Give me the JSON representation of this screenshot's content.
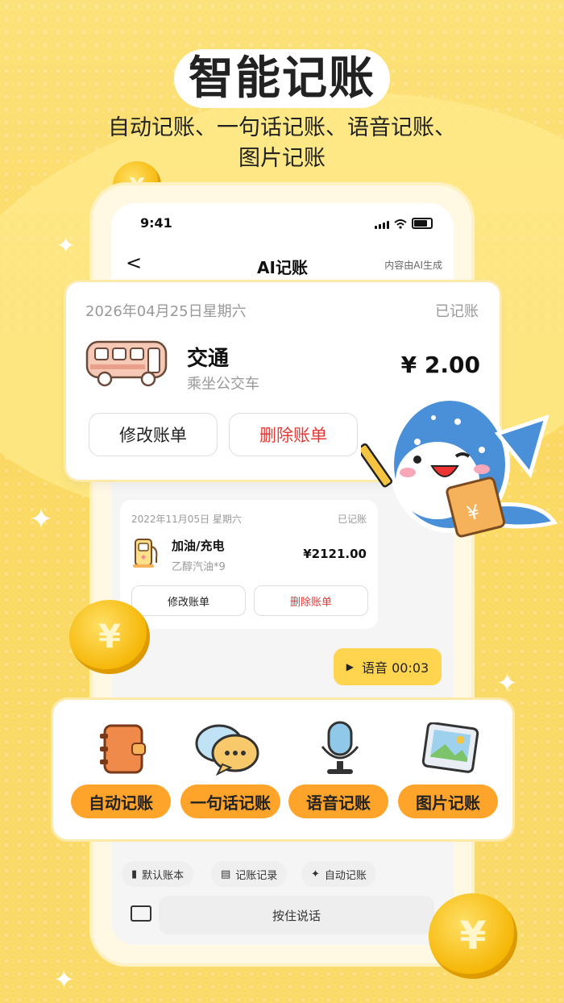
{
  "promo": {
    "title": "智能记账",
    "subtitle_line1": "自动记账、一句话记账、语音记账、",
    "subtitle_line2": "图片记账"
  },
  "status_bar": {
    "time": "9:41"
  },
  "nav": {
    "back": "<",
    "title": "AI记账",
    "note": "内容由AI生成"
  },
  "main_card": {
    "date": "2026年04月25日星期六",
    "status": "已记账",
    "category": "交通",
    "description": "乘坐公交车",
    "amount": "¥ 2.00",
    "edit_label": "修改账单",
    "delete_label": "删除账单"
  },
  "small_card": {
    "date": "2022年11月05日  星期六",
    "status": "已记账",
    "category": "加油/充电",
    "description": "乙醇汽油*9",
    "amount": "¥2121.00",
    "edit_label": "修改账单",
    "delete_label": "删除账单"
  },
  "voice_message": {
    "label": "语音 00:03"
  },
  "features": [
    {
      "label": "自动记账",
      "icon": "notebook-icon"
    },
    {
      "label": "一句话记账",
      "icon": "chat-bubble-icon"
    },
    {
      "label": "语音记账",
      "icon": "microphone-icon"
    },
    {
      "label": "图片记账",
      "icon": "picture-icon"
    }
  ],
  "chips": [
    {
      "label": "默认账本",
      "icon": "book-icon"
    },
    {
      "label": "记账记录",
      "icon": "record-icon"
    },
    {
      "label": "自动记账",
      "icon": "sparkle-icon"
    }
  ],
  "input": {
    "talk_label": "按住说话"
  },
  "colors": {
    "accent": "#FFA42B",
    "delete": "#E53935",
    "background": "#FCE27A"
  }
}
